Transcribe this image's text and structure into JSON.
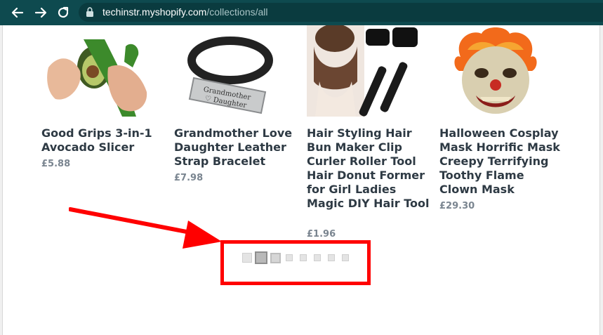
{
  "browser": {
    "url_host": "techinstr.myshopify.com",
    "url_path": "/collections/all"
  },
  "products": [
    {
      "title": "Good Grips 3-in-1 Avocado Slicer",
      "price": "£5.88",
      "image_icon": "avocado-slicer-image"
    },
    {
      "title": "Grandmother Love Daughter Leather Strap Bracelet",
      "price": "£7.98",
      "image_icon": "leather-bracelet-image"
    },
    {
      "title": "Hair Styling Hair Bun Maker Clip Curler Roller Tool Hair Donut Former for Girl Ladies Magic DIY Hair Tool",
      "price": "£1.96",
      "image_icon": "hair-bun-maker-image"
    },
    {
      "title": "Halloween Cosplay Mask Horrific Mask Creepy Terrifying Toothy Flame Clown Mask",
      "price": "£29.30",
      "image_icon": "clown-mask-image"
    }
  ],
  "bracelet_engraving": {
    "line1": "Grandmother",
    "line2": "♡ Daughter"
  },
  "pagination": {
    "total": 8,
    "active_index": 1
  },
  "annotation": {
    "color": "#ff0000"
  }
}
